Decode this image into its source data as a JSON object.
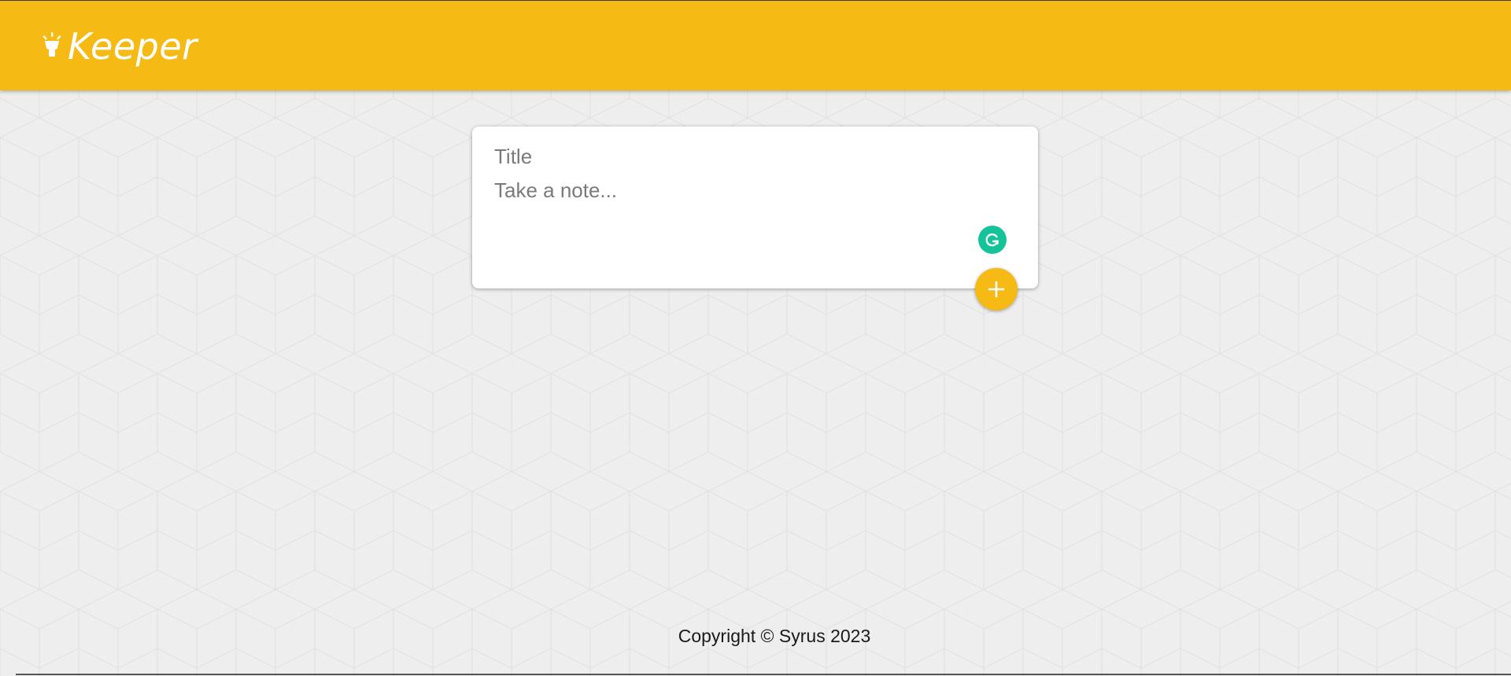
{
  "header": {
    "brand_name": "Keeper",
    "brand_icon": "lightbulb-icon",
    "background_color": "#f5ba13"
  },
  "note_form": {
    "title_placeholder": "Title",
    "content_placeholder": "Take a note...",
    "grammarly_icon": "grammarly-icon",
    "add_icon": "plus-icon"
  },
  "footer": {
    "copyright_text": "Copyright © Syrus 2023"
  },
  "colors": {
    "accent": "#f5ba13",
    "grammarly": "#15c39a",
    "page_background": "#eeeeee"
  }
}
